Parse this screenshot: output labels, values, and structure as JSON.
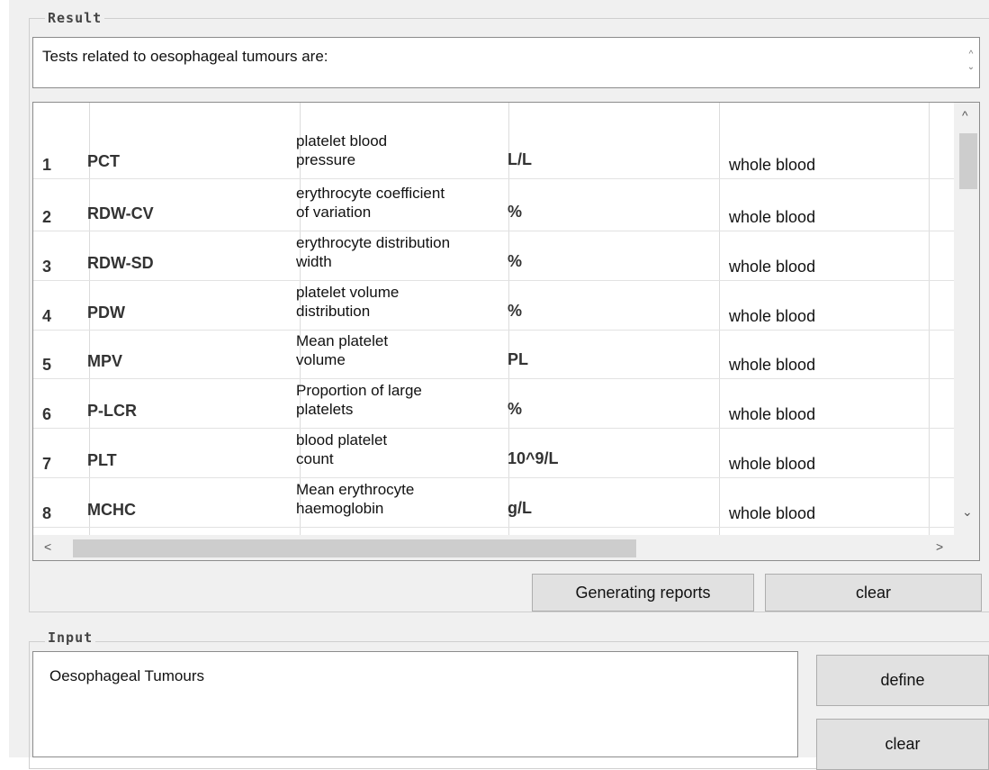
{
  "result": {
    "title": "Result",
    "text": "Tests related to oesophageal tumours are:",
    "table": {
      "rows": [
        {
          "index": "1",
          "code": "PCT",
          "name_line1": "platelet blood",
          "name_line2": "pressure",
          "unit": "L/L",
          "specimen": "whole blood"
        },
        {
          "index": "2",
          "code": "RDW-CV",
          "name_line1": "erythrocyte coefficient",
          "name_line2": "of variation",
          "unit": "%",
          "specimen": "whole blood"
        },
        {
          "index": "3",
          "code": "RDW-SD",
          "name_line1": "erythrocyte distribution",
          "name_line2": "width",
          "unit": "%",
          "specimen": "whole blood"
        },
        {
          "index": "4",
          "code": "PDW",
          "name_line1": "platelet volume",
          "name_line2": "distribution",
          "unit": "%",
          "specimen": "whole blood"
        },
        {
          "index": "5",
          "code": "MPV",
          "name_line1": "Mean platelet",
          "name_line2": "volume",
          "unit": "PL",
          "specimen": "whole blood"
        },
        {
          "index": "6",
          "code": "P-LCR",
          "name_line1": "Proportion of large",
          "name_line2": "platelets",
          "unit": "%",
          "specimen": "whole blood"
        },
        {
          "index": "7",
          "code": "PLT",
          "name_line1": "blood platelet",
          "name_line2": "count",
          "unit": "10^9/L",
          "specimen": "whole blood"
        },
        {
          "index": "8",
          "code": "MCHC",
          "name_line1": "Mean erythrocyte",
          "name_line2": "haemoglobin",
          "unit": "g/L",
          "specimen": "whole blood"
        }
      ]
    },
    "buttons": {
      "generate": "Generating reports",
      "clear": "clear"
    }
  },
  "input": {
    "title": "Input",
    "value": "Oesophageal Tumours",
    "buttons": {
      "define": "define",
      "clear": "clear"
    }
  },
  "icons": {
    "up": "chevron-up-icon",
    "down": "chevron-down-icon",
    "left": "chevron-left-icon",
    "right": "chevron-right-icon"
  }
}
